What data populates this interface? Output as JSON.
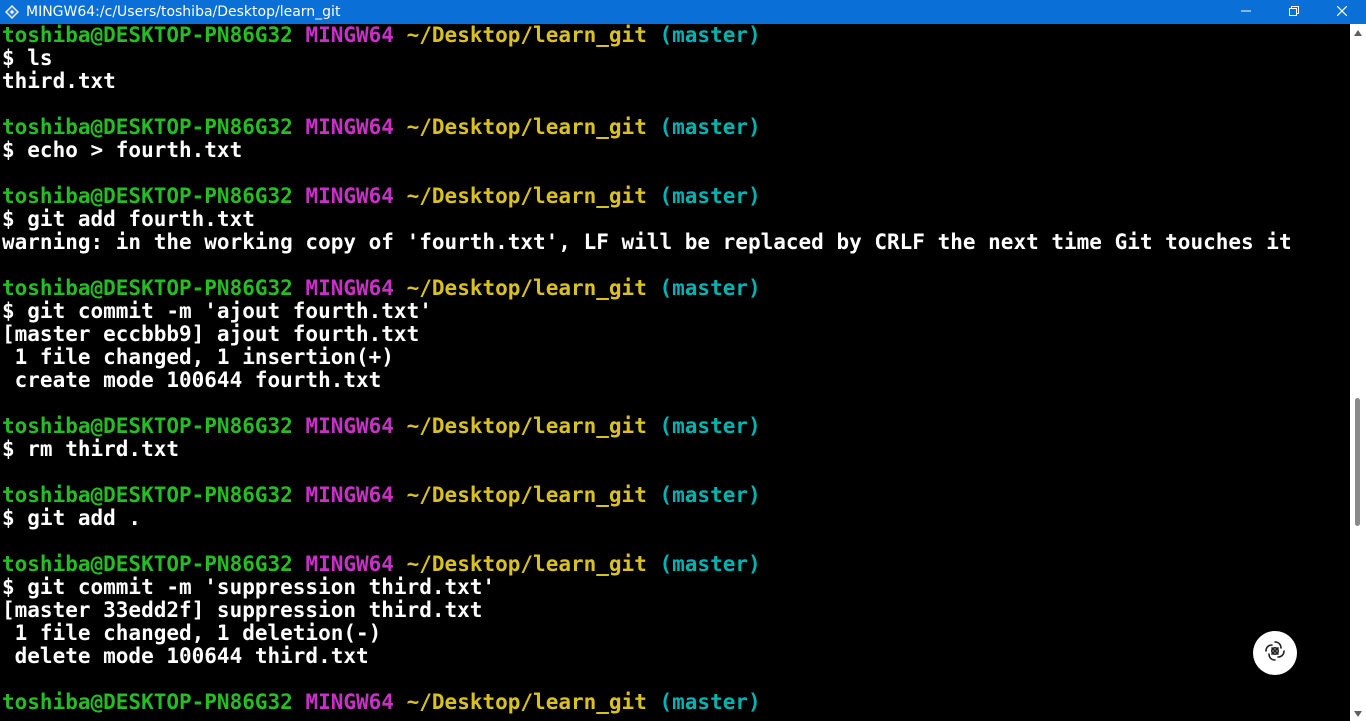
{
  "window": {
    "title": "MINGW64:/c/Users/toshiba/Desktop/learn_git",
    "icons": {
      "app": "git-bash-icon",
      "minimize": "minimize-icon",
      "maximize": "maximize-icon",
      "close": "close-icon",
      "assistant": "ai-assistant-icon"
    }
  },
  "colors": {
    "titlebar": "#0a6fd6",
    "user": "#25bc24",
    "system": "#c930c7",
    "path": "#d9c21f",
    "branch": "#00b3b3",
    "output": "#ffffff",
    "background": "#000000"
  },
  "prompt": {
    "user": "toshiba@DESKTOP-PN86G32",
    "system": "MINGW64",
    "path": "~/Desktop/learn_git",
    "branch": "(master)"
  },
  "lines": [
    {
      "kind": "prompt"
    },
    {
      "kind": "text",
      "text": "$ ls"
    },
    {
      "kind": "text",
      "text": "third.txt"
    },
    {
      "kind": "text",
      "text": ""
    },
    {
      "kind": "prompt"
    },
    {
      "kind": "text",
      "text": "$ echo > fourth.txt"
    },
    {
      "kind": "text",
      "text": ""
    },
    {
      "kind": "prompt"
    },
    {
      "kind": "text",
      "text": "$ git add fourth.txt"
    },
    {
      "kind": "text",
      "text": "warning: in the working copy of 'fourth.txt', LF will be replaced by CRLF the next time Git touches it"
    },
    {
      "kind": "text",
      "text": ""
    },
    {
      "kind": "prompt"
    },
    {
      "kind": "text",
      "text": "$ git commit -m 'ajout fourth.txt'"
    },
    {
      "kind": "text",
      "text": "[master eccbbb9] ajout fourth.txt"
    },
    {
      "kind": "text",
      "text": " 1 file changed, 1 insertion(+)"
    },
    {
      "kind": "text",
      "text": " create mode 100644 fourth.txt"
    },
    {
      "kind": "text",
      "text": ""
    },
    {
      "kind": "prompt"
    },
    {
      "kind": "text",
      "text": "$ rm third.txt"
    },
    {
      "kind": "text",
      "text": ""
    },
    {
      "kind": "prompt"
    },
    {
      "kind": "text",
      "text": "$ git add ."
    },
    {
      "kind": "text",
      "text": ""
    },
    {
      "kind": "prompt"
    },
    {
      "kind": "text",
      "text": "$ git commit -m 'suppression third.txt'"
    },
    {
      "kind": "text",
      "text": "[master 33edd2f] suppression third.txt"
    },
    {
      "kind": "text",
      "text": " 1 file changed, 1 deletion(-)"
    },
    {
      "kind": "text",
      "text": " delete mode 100644 third.txt"
    },
    {
      "kind": "text",
      "text": ""
    },
    {
      "kind": "prompt"
    }
  ],
  "scrollbar": {
    "position_fraction": 0.6
  }
}
